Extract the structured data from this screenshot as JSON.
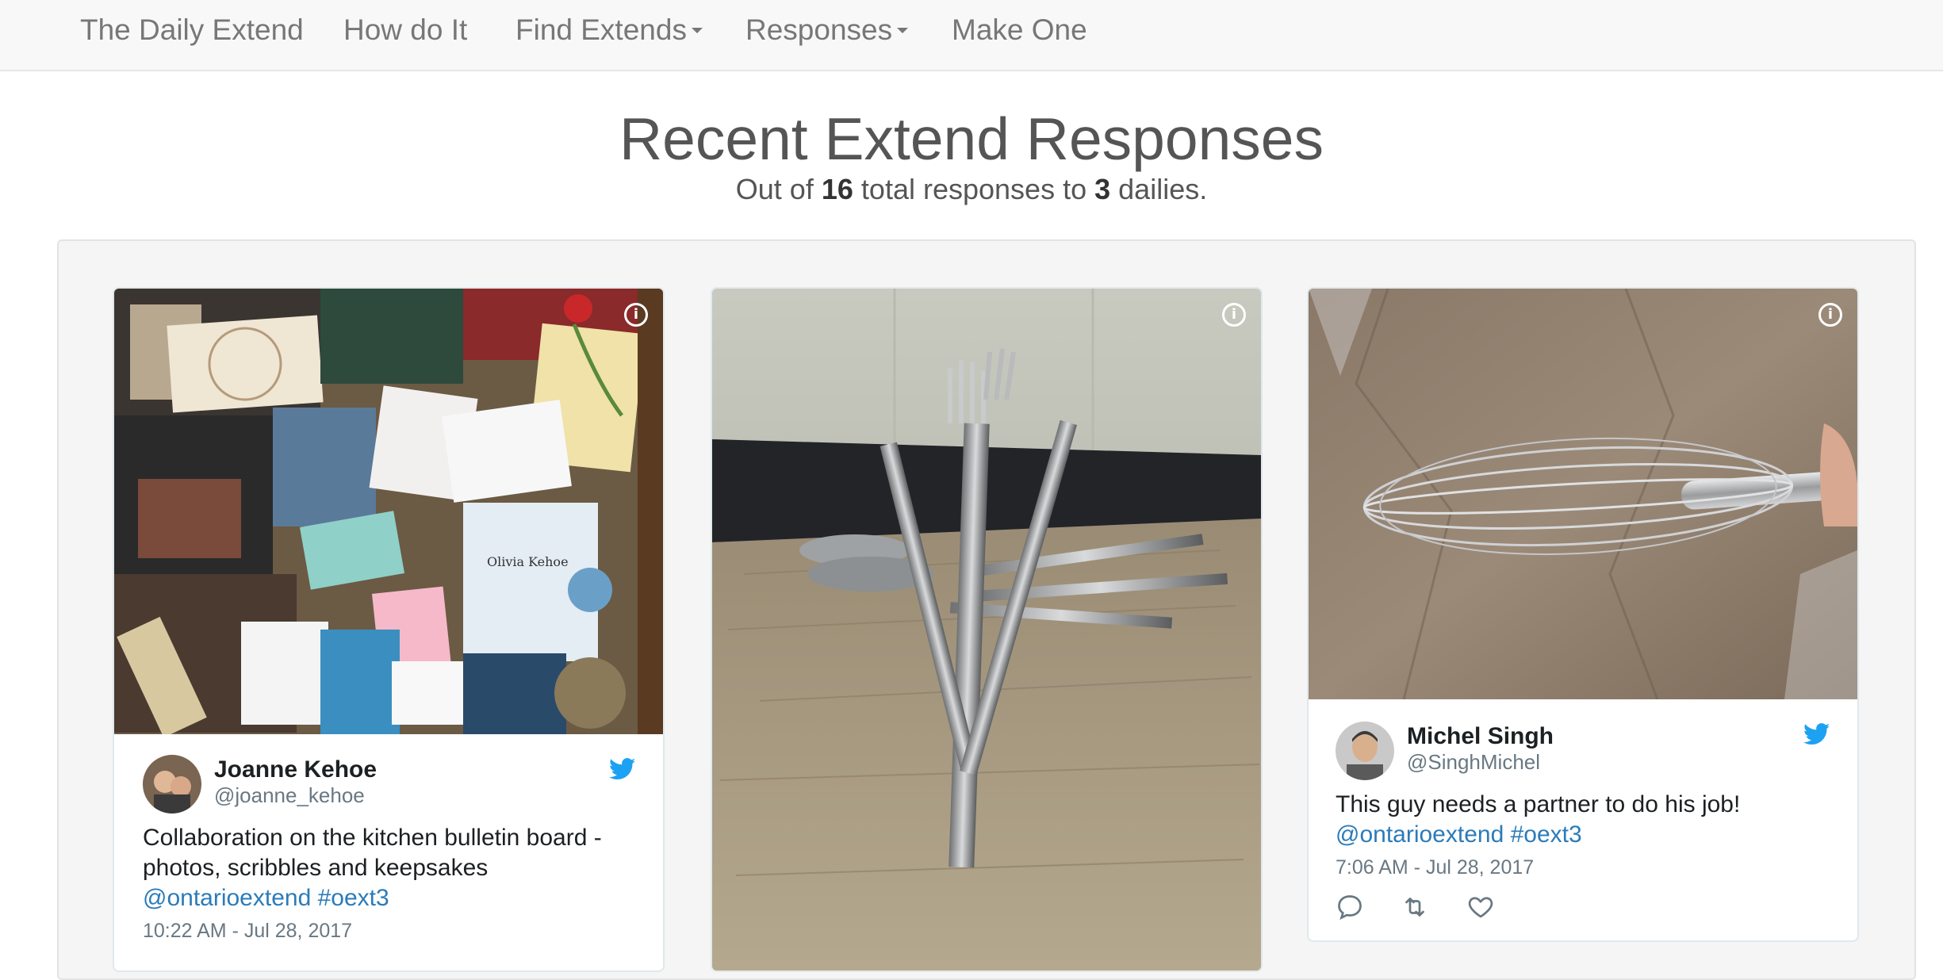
{
  "nav": {
    "items": [
      {
        "label": "The Daily Extend",
        "dropdown": false
      },
      {
        "label": "How do It",
        "dropdown": false
      },
      {
        "label": "Find Extends",
        "dropdown": true
      },
      {
        "label": "Responses",
        "dropdown": true
      },
      {
        "label": "Make One",
        "dropdown": false
      }
    ]
  },
  "header": {
    "title": "Recent Extend Responses",
    "sub_prefix": "Out of",
    "total_responses": "16",
    "sub_middle": "total responses to",
    "dailies_count": "3",
    "sub_suffix": "dailies."
  },
  "cards": [
    {
      "image_desc": "kitchen-bulletin-board-photo",
      "author_name": "Joanne Kehoe",
      "author_handle": "@joanne_kehoe",
      "text": "Collaboration on the kitchen bulletin board - photos, scribbles and keepsakes",
      "mention": "@ontarioextend",
      "hashtag": "#oext3",
      "time": "10:22 AM - Jul 28, 2017"
    },
    {
      "image_desc": "forks-standing-on-cutting-board-photo"
    },
    {
      "image_desc": "whisk-photo",
      "author_name": "Michel Singh",
      "author_handle": "@SinghMichel",
      "text": "This guy needs a partner to do his job!",
      "mention": "@ontarioextend",
      "hashtag": "#oext3",
      "time": "7:06 AM - Jul 28, 2017",
      "actions": [
        "reply-icon",
        "retweet-icon",
        "like-icon"
      ]
    }
  ],
  "colors": {
    "twitter_blue": "#1da1f2",
    "link_blue": "#2b7bb9",
    "nav_text": "#777777",
    "heading": "#555555"
  }
}
